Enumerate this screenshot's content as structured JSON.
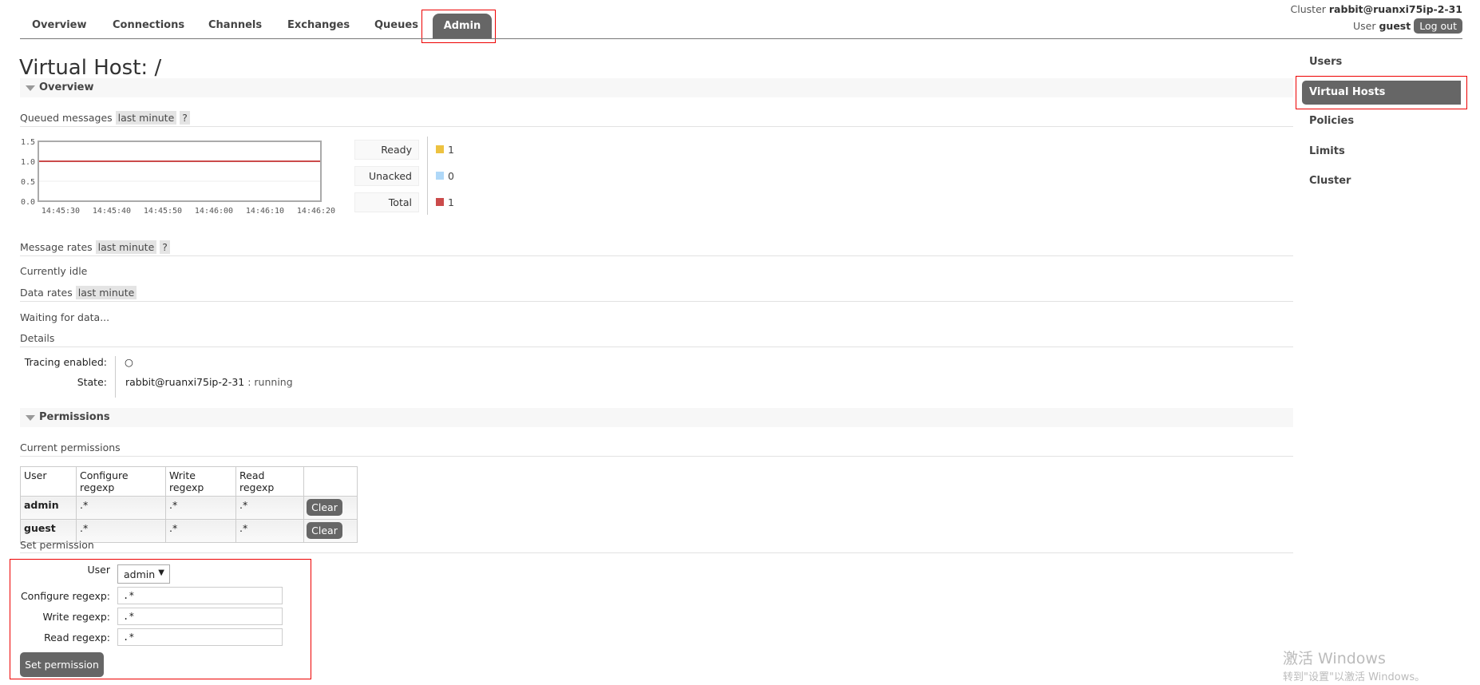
{
  "nav": {
    "tabs": [
      {
        "label": "Overview"
      },
      {
        "label": "Connections"
      },
      {
        "label": "Channels"
      },
      {
        "label": "Exchanges"
      },
      {
        "label": "Queues"
      },
      {
        "label": "Admin",
        "active": true
      }
    ]
  },
  "header": {
    "cluster_label": "Cluster",
    "cluster_name": "rabbit@ruanxi75ip-2-31",
    "user_label": "User",
    "user_name": "guest",
    "logout": "Log out"
  },
  "page_title": "Virtual Host: /",
  "sidebar": {
    "items": [
      {
        "label": "Users"
      },
      {
        "label": "Virtual Hosts",
        "active": true
      },
      {
        "label": "Policies"
      },
      {
        "label": "Limits"
      },
      {
        "label": "Cluster"
      }
    ]
  },
  "overview": {
    "title": "Overview",
    "queued_label": "Queued messages",
    "range": "last minute",
    "help": "?",
    "legend": [
      {
        "label": "Ready",
        "value": "1",
        "color": "#edc240"
      },
      {
        "label": "Unacked",
        "value": "0",
        "color": "#afd8f8"
      },
      {
        "label": "Total",
        "value": "1",
        "color": "#cb4b4b"
      }
    ],
    "message_rates_label": "Message rates",
    "message_rates_range": "last minute",
    "message_rates_help": "?",
    "idle": "Currently idle",
    "data_rates_label": "Data rates",
    "data_rates_range": "last minute",
    "waiting": "Waiting for data...",
    "details_label": "Details",
    "tracing_label": "Tracing enabled:",
    "tracing_value": "○",
    "state_label": "State:",
    "state_node": "rabbit@ruanxi75ip-2-31",
    "state_value": ": running"
  },
  "chart_data": {
    "type": "line",
    "x": [
      "14:45:30",
      "14:45:40",
      "14:45:50",
      "14:46:00",
      "14:46:10",
      "14:46:20"
    ],
    "yticks": [
      "0.0",
      "0.5",
      "1.0",
      "1.5"
    ],
    "ylim": [
      0,
      1.5
    ],
    "series": [
      {
        "name": "Ready",
        "values": [
          1,
          1,
          1,
          1,
          1,
          1
        ],
        "color": "#edc240"
      },
      {
        "name": "Unacked",
        "values": [
          0,
          0,
          0,
          0,
          0,
          0
        ],
        "color": "#afd8f8"
      },
      {
        "name": "Total",
        "values": [
          1,
          1,
          1,
          1,
          1,
          1
        ],
        "color": "#cb4b4b"
      }
    ],
    "grid": true
  },
  "permissions": {
    "title": "Permissions",
    "current_label": "Current permissions",
    "columns": [
      "User",
      "Configure regexp",
      "Write regexp",
      "Read regexp"
    ],
    "rows": [
      {
        "user": "admin",
        "configure": ".*",
        "write": ".*",
        "read": ".*",
        "action": "Clear"
      },
      {
        "user": "guest",
        "configure": ".*",
        "write": ".*",
        "read": ".*",
        "action": "Clear"
      }
    ],
    "set_label": "Set permission",
    "form": {
      "user_label": "User",
      "user_value": "admin",
      "configure_label": "Configure regexp:",
      "configure_value": ".*",
      "write_label": "Write regexp:",
      "write_value": ".*",
      "read_label": "Read regexp:",
      "read_value": ".*",
      "submit": "Set permission"
    }
  },
  "watermark": {
    "line1": "激活 Windows",
    "line2": "转到\"设置\"以激活 Windows。"
  }
}
